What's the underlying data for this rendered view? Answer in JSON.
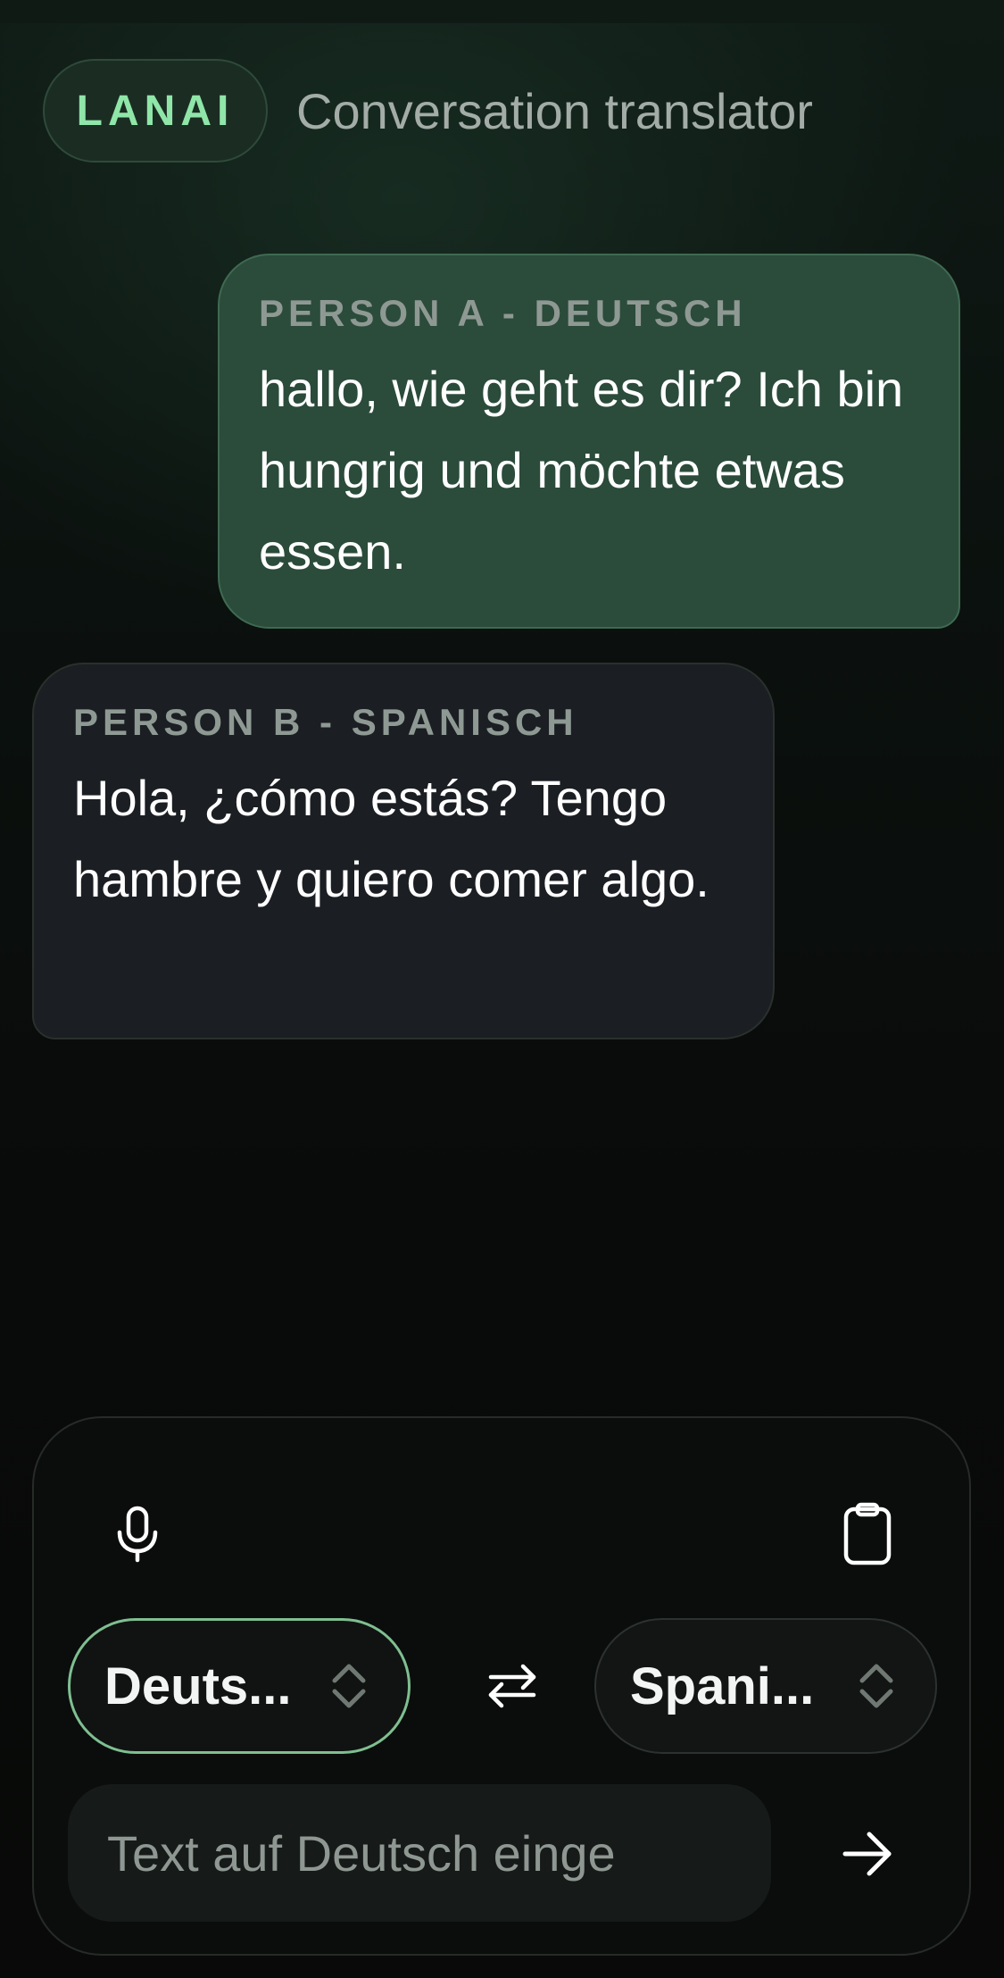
{
  "header": {
    "brand": "LANAI",
    "title": "Conversation translator"
  },
  "messages": [
    {
      "label": "PERSON A - DEUTSCH",
      "text": "hallo, wie geht es dir? Ich bin hungrig und möchte etwas essen."
    },
    {
      "label": "PERSON B - SPANISCH",
      "text": "Hola, ¿cómo estás? Tengo hambre y quiero comer algo."
    }
  ],
  "composer": {
    "mic_icon": "microphone-icon",
    "clipboard_icon": "clipboard-icon",
    "source_language": "Deuts...",
    "target_language": "Spani...",
    "swap_icon": "swap-arrows-icon",
    "input_value": "",
    "input_placeholder": "Text auf Deutsch einge",
    "send_icon": "arrow-right-icon"
  },
  "colors": {
    "accent": "#8fe6a8",
    "bubble_a": "#2b4b3b",
    "bubble_b": "#1b1e22",
    "source_border": "#7fbf91"
  }
}
